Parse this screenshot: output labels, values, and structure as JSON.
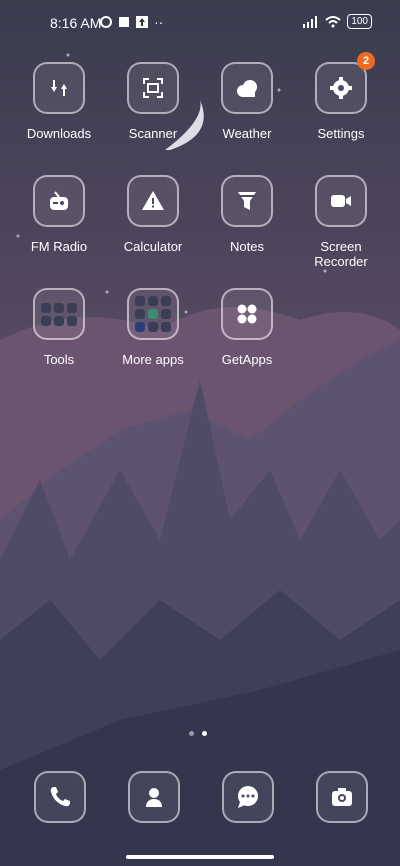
{
  "status": {
    "time": "8:16 AM",
    "battery": "100"
  },
  "apps": [
    {
      "label": "Downloads",
      "icon": "downloads-icon"
    },
    {
      "label": "Scanner",
      "icon": "scanner-icon"
    },
    {
      "label": "Weather",
      "icon": "weather-icon"
    },
    {
      "label": "Settings",
      "icon": "gear-icon",
      "badge": "2"
    },
    {
      "label": "FM Radio",
      "icon": "radio-icon"
    },
    {
      "label": "Calculator",
      "icon": "calculator-icon"
    },
    {
      "label": "Notes",
      "icon": "notes-icon"
    },
    {
      "label": "Screen\nRecorder",
      "icon": "video-camera-icon"
    },
    {
      "label": "Tools",
      "icon": "folder-icon"
    },
    {
      "label": "More apps",
      "icon": "folder-icon"
    },
    {
      "label": "GetApps",
      "icon": "getapps-icon"
    }
  ],
  "dock": [
    "phone-icon",
    "contacts-icon",
    "messages-icon",
    "camera-icon"
  ],
  "pager": {
    "pages": 2,
    "current": 2
  }
}
